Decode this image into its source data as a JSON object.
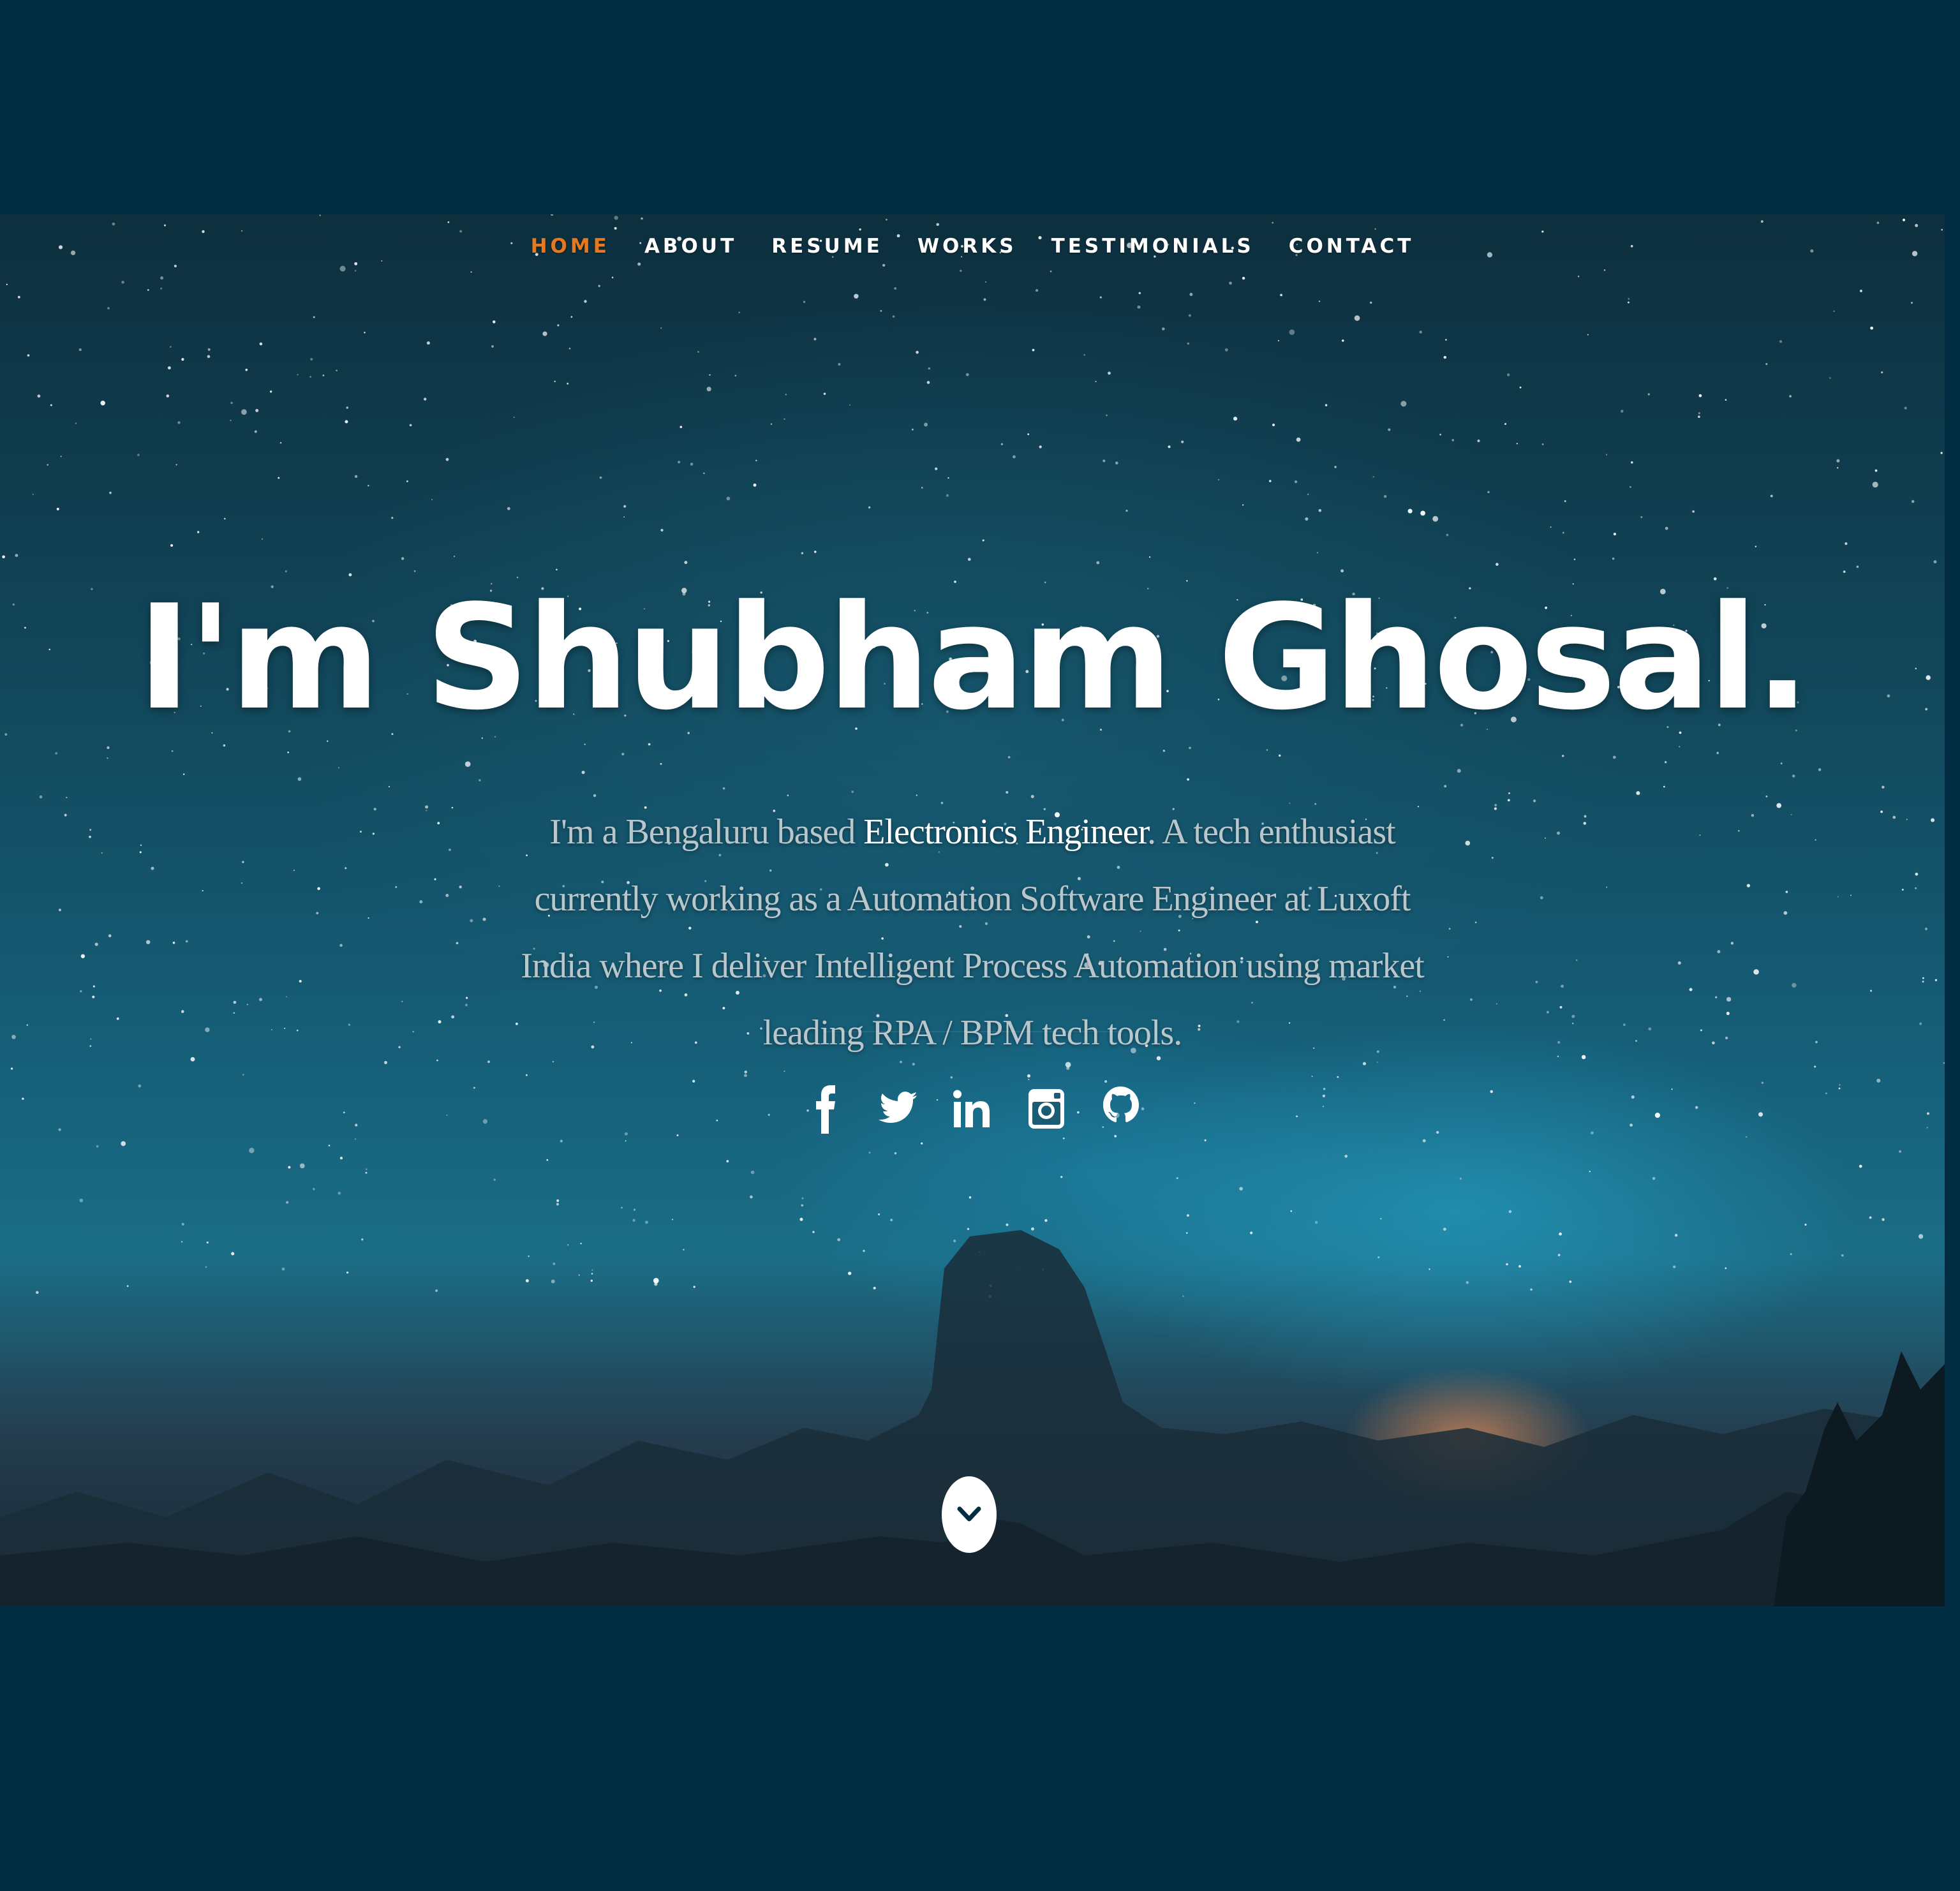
{
  "nav": {
    "items": [
      {
        "label": "HOME",
        "active": true
      },
      {
        "label": "ABOUT",
        "active": false
      },
      {
        "label": "RESUME",
        "active": false
      },
      {
        "label": "WORKS",
        "active": false
      },
      {
        "label": "TESTIMONIALS",
        "active": false
      },
      {
        "label": "CONTACT",
        "active": false
      }
    ],
    "active_color": "#e8781e"
  },
  "hero": {
    "headline": "I'm Shubham Ghosal.",
    "intro_before": "I'm a Bengaluru based ",
    "intro_highlight": "Electronics Engineer",
    "intro_after": ". A tech enthusiast currently working as a Automation Software Engineer at Luxoft India where I deliver Intelligent Process Automation using market leading RPA / BPM tech tools."
  },
  "social": [
    {
      "icon": "facebook-icon"
    },
    {
      "icon": "twitter-icon"
    },
    {
      "icon": "linkedin-icon"
    },
    {
      "icon": "instagram-icon"
    },
    {
      "icon": "github-icon"
    }
  ],
  "scroll_button": {
    "icon": "chevron-down-icon"
  },
  "colors": {
    "background": "#022d43",
    "text": "#ffffff",
    "muted_text": "#b9c6cc",
    "accent": "#e8781e"
  }
}
